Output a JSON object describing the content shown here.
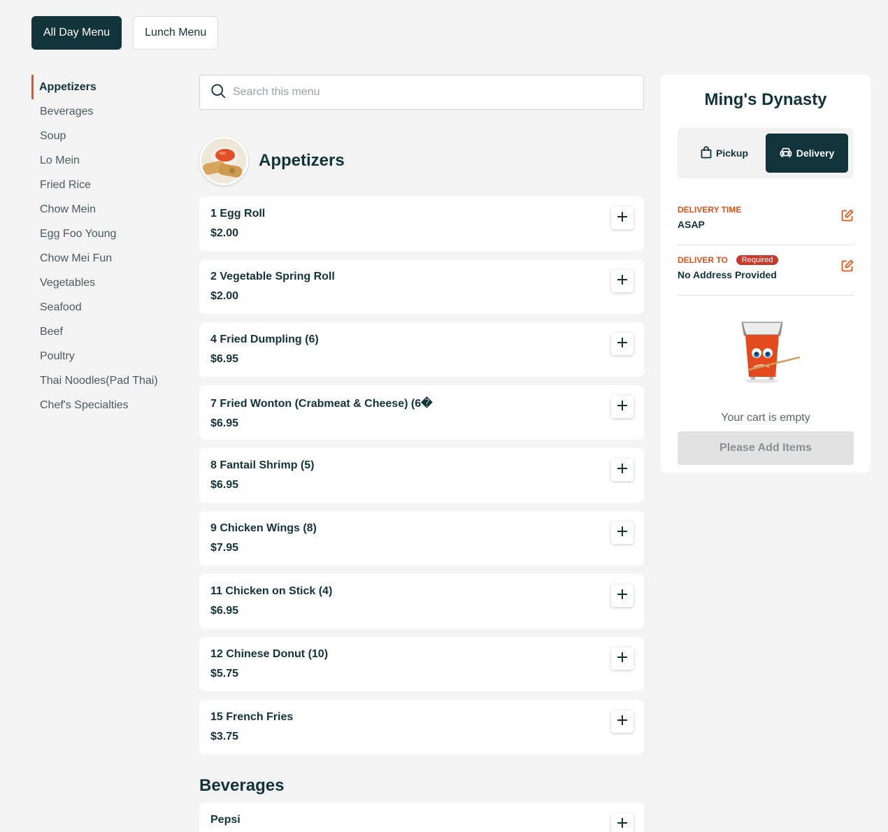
{
  "menu_tabs": [
    {
      "label": "All Day Menu",
      "active": true
    },
    {
      "label": "Lunch Menu",
      "active": false
    }
  ],
  "categories": [
    "Appetizers",
    "Beverages",
    "Soup",
    "Lo Mein",
    "Fried Rice",
    "Chow Mein",
    "Egg Foo Young",
    "Chow Mei Fun",
    "Vegetables",
    "Seafood",
    "Beef",
    "Poultry",
    "Thai Noodles(Pad Thai)",
    "Chef's Specialties"
  ],
  "active_category": "Appetizers",
  "search": {
    "placeholder": "Search this menu"
  },
  "section": {
    "title": "Appetizers",
    "items": [
      {
        "name": "1 Egg Roll",
        "price": "$2.00"
      },
      {
        "name": "2 Vegetable Spring Roll",
        "price": "$2.00"
      },
      {
        "name": "4 Fried Dumpling (6)",
        "price": "$6.95"
      },
      {
        "name": "7 Fried Wonton (Crabmeat & Cheese) (6�",
        "price": "$6.95"
      },
      {
        "name": "8 Fantail Shrimp (5)",
        "price": "$6.95"
      },
      {
        "name": "9 Chicken Wings (8)",
        "price": "$7.95"
      },
      {
        "name": "11 Chicken on Stick (4)",
        "price": "$6.95"
      },
      {
        "name": "12 Chinese Donut (10)",
        "price": "$5.75"
      },
      {
        "name": "15 French Fries",
        "price": "$3.75"
      }
    ]
  },
  "section2": {
    "title": "Beverages",
    "items": [
      {
        "name": "Pepsi"
      }
    ]
  },
  "cart": {
    "restaurant": "Ming's Dynasty",
    "pickup_label": "Pickup",
    "delivery_label": "Delivery",
    "delivery_time_label": "DELIVERY TIME",
    "delivery_time_value": "ASAP",
    "deliver_to_label": "DELIVER TO",
    "required_badge": "Required",
    "deliver_to_value": "No Address Provided",
    "empty_text": "Your cart is empty",
    "cta_label": "Please Add Items"
  },
  "colors": {
    "primary": "#11333a",
    "accent": "#e0561f",
    "badge": "#c93a2c"
  }
}
